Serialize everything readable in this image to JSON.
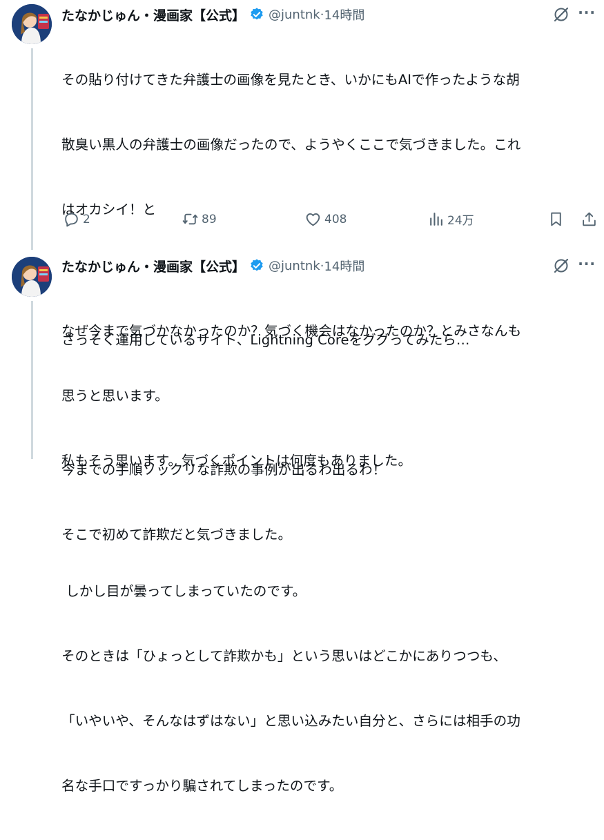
{
  "tweets": [
    {
      "author_name": "たなかじゅん・漫画家【公式】",
      "handle": "@juntnk",
      "time": "14時間",
      "lines": [
        "その貼り付けてきた弁護士の画像を見たとき、いかにもAIで作ったような胡",
        "散臭い黒人の弁護士の画像だったので、ようやくここで気づきました。これ",
        "はオカシイ！と",
        "",
        "さっそく運用しているサイト、Lightning Coreをググってみたら…",
        "",
        "今までの手順ソックリな詐欺の事例が出るわ出るわ！",
        "そこで初めて詐欺だと気づきました。"
      ],
      "stats": {
        "replies": "2",
        "reposts": "89",
        "likes": "408",
        "views": "24万"
      }
    },
    {
      "author_name": "たなかじゅん・漫画家【公式】",
      "handle": "@juntnk",
      "time": "14時間",
      "lines": [
        "なぜ今まで気づかなかったのか？気づく機会はなかったのか？とみさなんも",
        "思うと思います。",
        "私もそう思います。気づくポイントは何度もありました。",
        "",
        " しかし目が曇ってしまっていたのです。",
        "そのときは「ひょっとして詐欺かも」という思いはどこかにありつつも、",
        "「いやいや、そんなはずはない」と思い込みたい自分と、さらには相手の功",
        "名な手口ですっかり騙されてしまったのです。"
      ]
    }
  ],
  "separator": " · ",
  "more_glyph": "···",
  "colors": {
    "verified": "#1d9bf0",
    "muted": "#536471",
    "thread": "#cfd9de"
  },
  "icons": [
    "grok-icon",
    "more-icon",
    "reply-icon",
    "repost-icon",
    "like-icon",
    "views-icon",
    "bookmark-icon",
    "share-icon",
    "verified-badge-icon"
  ]
}
